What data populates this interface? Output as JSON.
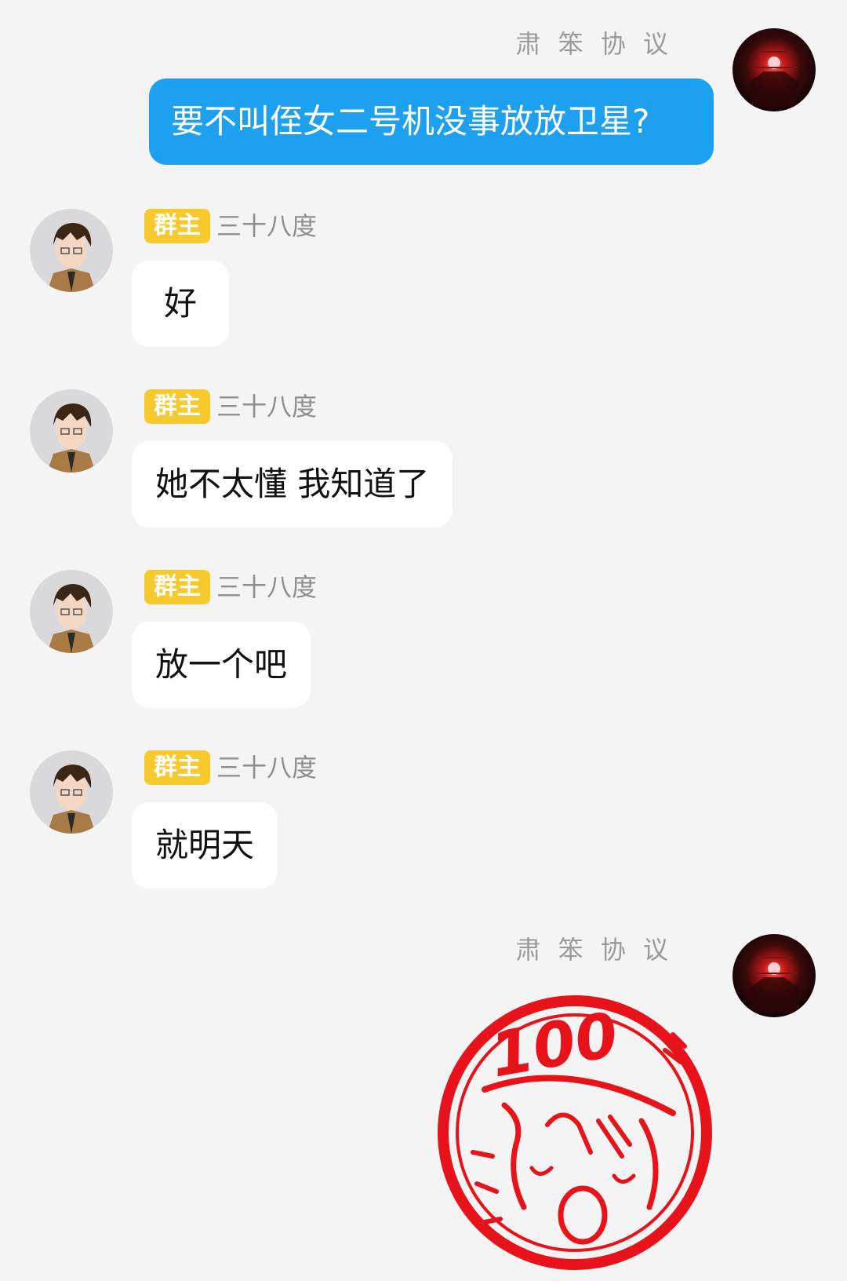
{
  "messages": [
    {
      "direction": "out",
      "sender": "肃 笨 协 议",
      "text": "要不叫侄女二号机没事放放卫星?"
    },
    {
      "direction": "in",
      "badge": "群主",
      "sender": "三十八度",
      "text": "好"
    },
    {
      "direction": "in",
      "badge": "群主",
      "sender": "三十八度",
      "text": "她不太懂 我知道了"
    },
    {
      "direction": "in",
      "badge": "群主",
      "sender": "三十八度",
      "text": "放一个吧"
    },
    {
      "direction": "in",
      "badge": "群主",
      "sender": "三十八度",
      "text": "就明天"
    },
    {
      "direction": "out",
      "sender": "肃 笨 协 议",
      "sticker": {
        "name": "stamp-100-sticker",
        "text": "100",
        "color": "#e8121a"
      }
    }
  ],
  "colors": {
    "background": "#f4f4f4",
    "outgoing_bubble": "#1ea0f0",
    "incoming_bubble": "#ffffff",
    "badge": "#f8c92d"
  }
}
